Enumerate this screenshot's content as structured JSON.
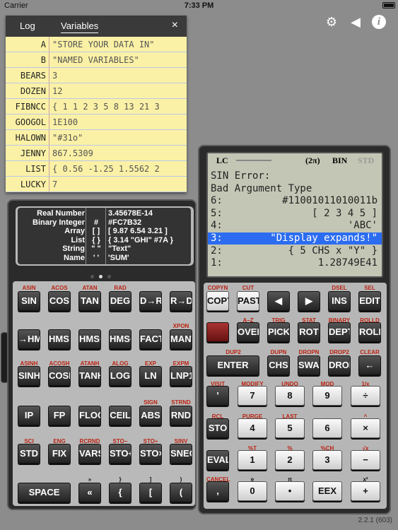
{
  "status": {
    "carrier": "Carrier",
    "time": "7:33 PM",
    "signal": "●"
  },
  "topbar": {
    "gear": "⚙",
    "speaker": "◀",
    "info": "i"
  },
  "varpanel": {
    "tabs": [
      "Log",
      "Variables"
    ],
    "close": "×",
    "rows": [
      {
        "name": "A",
        "value": "\"STORE YOUR DATA IN\""
      },
      {
        "name": "B",
        "value": "\"NAMED VARIABLES\""
      },
      {
        "name": "BEARS",
        "value": "3"
      },
      {
        "name": "DOZEN",
        "value": "12"
      },
      {
        "name": "FIBNCC",
        "value": "{ 1 1 2 3 5 8 13 21 3"
      },
      {
        "name": "GOOGOL",
        "value": "1E100"
      },
      {
        "name": "HALOWN",
        "value": "\"#31o\""
      },
      {
        "name": "JENNY",
        "value": "867.5309"
      },
      {
        "name": "LIST",
        "value": "{ 0.56 -1.25 1.5562 2"
      },
      {
        "name": "LUCKY",
        "value": "7"
      }
    ]
  },
  "typepanel": [
    {
      "name": "Real Number",
      "sym": "",
      "ex": "3.45678E-14"
    },
    {
      "name": "Binary Integer",
      "sym": "#",
      "ex": "#FC7B32"
    },
    {
      "name": "Array",
      "sym": "[ ]",
      "ex": "[ 9.87 6.54 3.21 ]"
    },
    {
      "name": "List",
      "sym": "{ }",
      "ex": "{ 3.14 \"GHI\" #7A }"
    },
    {
      "name": "String",
      "sym": "\" \"",
      "ex": "\"Text\""
    },
    {
      "name": "Name",
      "sym": "' '",
      "ex": "'SUM'"
    }
  ],
  "screen": {
    "annunciators": {
      "lc": "LC",
      "mode": "(2π)",
      "base": "BIN",
      "std": "STD"
    },
    "lines": [
      {
        "n": "SIN Error:",
        "v": ""
      },
      {
        "n": "Bad Argument Type",
        "v": ""
      },
      {
        "n": "6:",
        "v": "#11001011010011b"
      },
      {
        "n": "5:",
        "v": "[ 2 3 4 5 ]"
      },
      {
        "n": "4:",
        "v": "'ABC'"
      },
      {
        "n": "3:",
        "v": "\"Display expands!\""
      },
      {
        "n": "2:",
        "v": "{ 5 CHS x \"Y\" }"
      },
      {
        "n": "1:",
        "v": "1.28749E41"
      }
    ]
  },
  "leftkeys": {
    "labels": [
      "ASIN",
      "ACOS",
      "ATAN",
      "RAD",
      "XPON",
      "ASINH",
      "ACOSH",
      "ATANH",
      "ALOG",
      "EXP",
      "EXPM",
      "SIGN",
      "STRND",
      "SCI",
      "ENG",
      "RCRND",
      "STO−",
      "STO÷",
      "SINV",
      "»",
      "}",
      "]",
      ")"
    ],
    "row1": [
      "SIN",
      "COS",
      "TAN",
      "DEG",
      "D→R",
      "R→D"
    ],
    "row2": [
      "→HMS",
      "HMS→",
      "HMS+",
      "HMS−",
      "FACT",
      "MANT"
    ],
    "row3": [
      "SINH",
      "COSH",
      "TANH",
      "LOG",
      "LN",
      "LNP1"
    ],
    "row4": [
      "IP",
      "FP",
      "FLOOR",
      "CEIL",
      "ABS",
      "RND"
    ],
    "row5": [
      "STD",
      "FIX",
      "VARS",
      "STO+",
      "STO×",
      "SNEG"
    ],
    "row6": [
      "SPACE",
      "«",
      "{",
      "[",
      "("
    ]
  },
  "rightkeys": {
    "labels": [
      "COPYN",
      "CUT",
      "DSEL",
      "SEL",
      "A–Z",
      "TRIG",
      "STAT",
      "BINARY",
      "ROLLD",
      "DUP2",
      "DUPN",
      "DROPN",
      "DROP2",
      "CLEAR",
      "VISIT",
      "MODIFY",
      "UNDO",
      "MOD",
      "1/x",
      "RCL",
      "PURGE",
      "LAST",
      "^",
      "%T",
      "%",
      "%CH",
      "√x",
      "CANCEL",
      "e",
      "π",
      "x²"
    ],
    "row1": [
      "COPY",
      "PASTE",
      "◀",
      "▶",
      "INS",
      "EDIT"
    ],
    "row2": [
      "",
      "OVER",
      "PICK",
      "ROT",
      "DEPTH",
      "ROLL"
    ],
    "row3": [
      "ENTER",
      "CHS",
      "SWAP",
      "DROP",
      "←"
    ],
    "row4": [
      "'",
      "7",
      "8",
      "9",
      "÷"
    ],
    "row5": [
      "STO",
      "4",
      "5",
      "6",
      "×"
    ],
    "row6": [
      "EVAL",
      "1",
      "2",
      "3",
      "−"
    ],
    "row7": [
      ",",
      "0",
      "•",
      "EEX",
      "+"
    ]
  },
  "version": "2.2.1 (603)"
}
